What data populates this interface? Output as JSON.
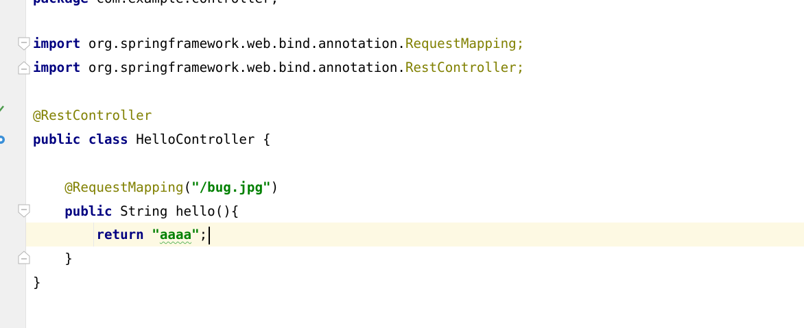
{
  "editor": {
    "lines": [
      {
        "tokens": [
          {
            "t": "package",
            "c": "kw"
          },
          {
            "t": " com.example.controller;",
            "c": "plain"
          }
        ]
      },
      {
        "tokens": [
          {
            "t": "import",
            "c": "kw"
          },
          {
            "t": " org.springframework.web.bind.annotation.",
            "c": "plain"
          },
          {
            "t": "RequestMapping",
            "c": "anno"
          },
          {
            "t": ";",
            "c": "anno"
          }
        ]
      },
      {
        "tokens": [
          {
            "t": "import",
            "c": "kw"
          },
          {
            "t": " org.springframework.web.bind.annotation.",
            "c": "plain"
          },
          {
            "t": "RestController",
            "c": "anno"
          },
          {
            "t": ";",
            "c": "anno"
          }
        ]
      },
      {
        "tokens": [
          {
            "t": "@RestController",
            "c": "anno"
          }
        ]
      },
      {
        "tokens": [
          {
            "t": "public",
            "c": "kw"
          },
          {
            "t": " ",
            "c": "plain"
          },
          {
            "t": "class",
            "c": "kw"
          },
          {
            "t": " HelloController {",
            "c": "plain"
          }
        ]
      },
      {
        "tokens": [
          {
            "t": "    ",
            "c": "plain"
          },
          {
            "t": "@RequestMapping",
            "c": "anno"
          },
          {
            "t": "(",
            "c": "plain"
          },
          {
            "t": "\"/bug.jpg\"",
            "c": "str"
          },
          {
            "t": ")",
            "c": "plain"
          }
        ]
      },
      {
        "tokens": [
          {
            "t": "    ",
            "c": "plain"
          },
          {
            "t": "public",
            "c": "kw"
          },
          {
            "t": " String hello(){",
            "c": "plain"
          }
        ]
      },
      {
        "tokens": [
          {
            "t": "        ",
            "c": "plain"
          },
          {
            "t": "return",
            "c": "kw"
          },
          {
            "t": " ",
            "c": "plain"
          },
          {
            "t": "\"",
            "c": "str"
          },
          {
            "t": "aaaa",
            "c": "str squiggle"
          },
          {
            "t": "\"",
            "c": "str"
          },
          {
            "t": ";",
            "c": "plain"
          }
        ]
      },
      {
        "tokens": [
          {
            "t": "    }",
            "c": "plain"
          }
        ]
      },
      {
        "tokens": [
          {
            "t": "}",
            "c": "plain"
          }
        ]
      }
    ],
    "caret_line_index": 7
  },
  "gutter": {
    "icons": [
      "implemented-bean-icon",
      "spring-bean-icon"
    ]
  },
  "colors": {
    "keyword": "#000080",
    "annotation": "#808000",
    "string": "#008000",
    "caret_line": "#fdf9e3",
    "gutter_bg": "#f0f0f0"
  }
}
